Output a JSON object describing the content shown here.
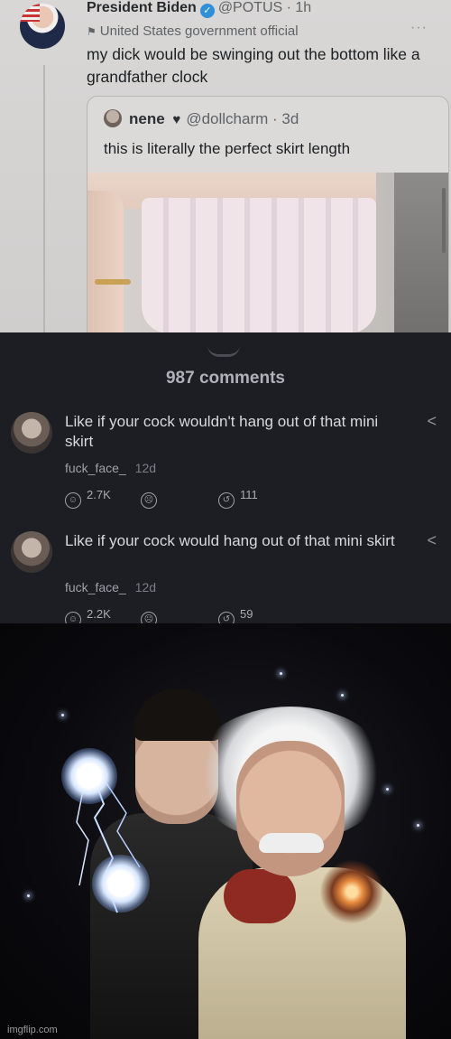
{
  "tweet": {
    "author_name": "President Biden",
    "handle": "@POTUS",
    "time": "· 1h",
    "label": "United States government official",
    "more": "···",
    "text": "my dick would be swinging out the bottom like a grandfather clock",
    "quote": {
      "author_name": "nene",
      "heart": "♥",
      "handle": "@dollcharm · 3d",
      "text": "this is literally the perfect skirt length"
    }
  },
  "comments_panel": {
    "count_label": "987 comments",
    "comments": [
      {
        "text": "Like if your cock wouldn't hang out of that mini skirt",
        "author": "fuck_face_",
        "time": "12d",
        "likes": "2.7K",
        "replies": "111"
      },
      {
        "text": "Like if your cock would hang out of that mini skirt",
        "author": "fuck_face_",
        "time": "12d",
        "likes": "2.2K",
        "replies": "59"
      }
    ]
  },
  "watermark": "imgflip.com",
  "icons": [
    "verified-icon",
    "flag-icon",
    "more-icon",
    "heart-icon",
    "share-icon",
    "like-icon",
    "dislike-icon",
    "reply-icon",
    "drag-handle-icon"
  ],
  "colors": {
    "tweet_bg": "#d9d7d6",
    "comments_bg": "#1c1e24",
    "verified": "#2f8fd8",
    "art_bg": "#0a0a0e"
  }
}
